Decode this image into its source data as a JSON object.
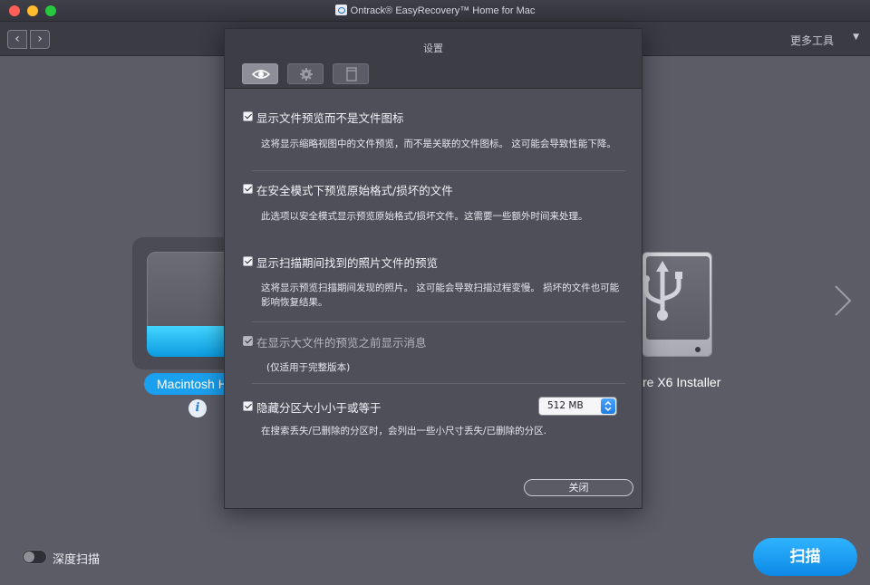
{
  "window": {
    "title": "Ontrack® EasyRecovery™ Home for Mac"
  },
  "toolbar": {
    "back_glyph": "‹",
    "forward_glyph": "›",
    "more_tools": "更多工具",
    "more_caret": "▼"
  },
  "drives": {
    "left_label": "Macintosh H",
    "info_glyph": "i",
    "right_label": "re X6 Installer"
  },
  "footer": {
    "deep_scan_label": "深度扫描",
    "scan_button": "扫描"
  },
  "settings": {
    "title": "设置",
    "tabs": [
      {
        "icon": "eye-icon",
        "active": true
      },
      {
        "icon": "gear-icon",
        "active": false
      },
      {
        "icon": "panel-icon",
        "active": false
      }
    ],
    "options": [
      {
        "label": "显示文件预览而不是文件图标",
        "checked": true,
        "enabled": true,
        "description": "这将显示缩略视图中的文件预览，而不是关联的文件图标。 这可能会导致性能下降。"
      },
      {
        "label": "在安全模式下预览原始格式/损坏的文件",
        "checked": true,
        "enabled": true,
        "description": "此选项以安全模式显示预览原始格式/损坏文件。这需要一些额外时间来处理。"
      },
      {
        "label": "显示扫描期间找到的照片文件的预览",
        "checked": true,
        "enabled": true,
        "description": "这将显示预览扫描期间发现的照片。 这可能会导致扫描过程变慢。 损坏的文件也可能影响恢复结果。"
      },
      {
        "label": "在显示大文件的预览之前显示消息",
        "checked": true,
        "enabled": false,
        "description": "(仅适用于完整版本)"
      },
      {
        "label": "隐藏分区大小小于或等于",
        "checked": true,
        "enabled": true,
        "description": "在搜索丢失/已删除的分区时，会列出一些小尺寸丢失/已删除的分区."
      }
    ],
    "partition_size": "512 MB",
    "close_button": "关闭"
  }
}
